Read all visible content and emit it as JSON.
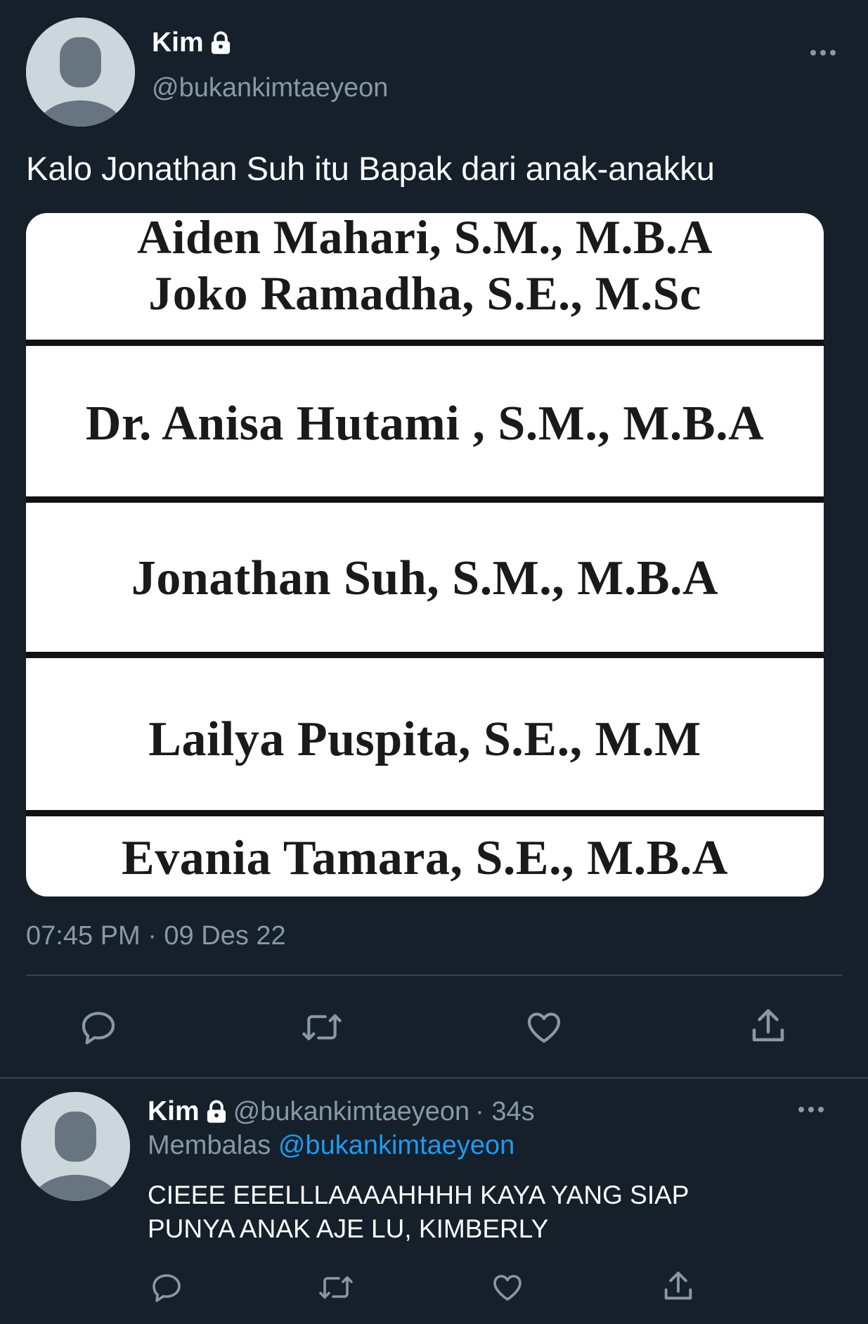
{
  "tweet": {
    "display_name": "Kim",
    "handle": "@bukankimtaeyeon",
    "text": "Kalo Jonathan Suh itu Bapak dari anak-anakku",
    "timestamp": "07:45 PM · 09 Des 22",
    "media": {
      "lines": [
        "Aiden Mahari, S.M., M.B.A",
        "Joko Ramadha, S.E., M.Sc",
        "Dr. Anisa Hutami , S.M., M.B.A",
        "Jonathan Suh, S.M., M.B.A",
        "Lailya Puspita, S.E., M.M",
        "Evania Tamara, S.E., M.B.A"
      ]
    }
  },
  "reply": {
    "display_name": "Kim",
    "handle": "@bukankimtaeyeon",
    "age": "· 34s",
    "replying_label": "Membalas",
    "replying_to": "@bukankimtaeyeon",
    "text_line1": "CIEEE EEELLLAAAAHHHH KAYA YANG SIAP",
    "text_line2": "PUNYA ANAK AJE LU, KIMBERLY"
  },
  "icons": {
    "reply": "reply-icon",
    "retweet": "retweet-icon",
    "like": "heart-icon",
    "share": "share-icon",
    "more": "more-icon",
    "lock": "lock-icon"
  },
  "colors": {
    "background": "#15202b",
    "muted": "#8899a6",
    "link": "#1d9bf0",
    "divider": "#38444d"
  }
}
